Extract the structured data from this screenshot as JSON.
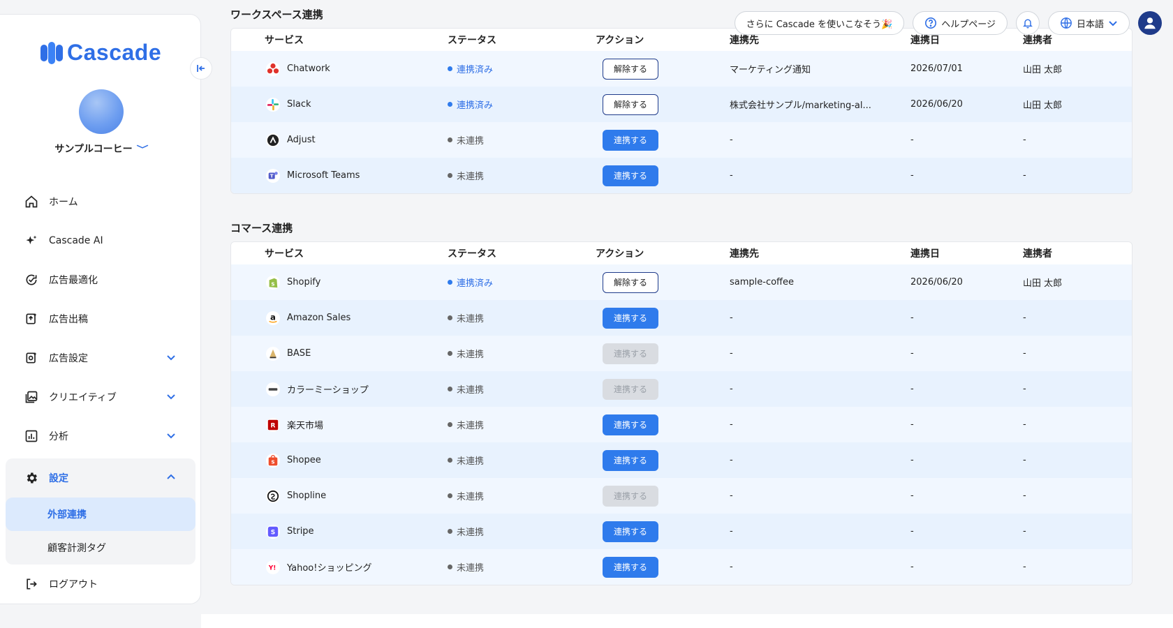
{
  "brand": {
    "name": "Cascade",
    "color": "#2f6fe6"
  },
  "company": {
    "name": "サンプルコーヒー"
  },
  "nav": {
    "items": [
      {
        "label": "ホーム",
        "icon": "home-icon"
      },
      {
        "label": "Cascade AI",
        "icon": "sparkle-icon"
      },
      {
        "label": "広告最適化",
        "icon": "refresh-check-icon"
      },
      {
        "label": "広告出稿",
        "icon": "upload-doc-icon"
      },
      {
        "label": "広告設定",
        "icon": "ad-settings-icon",
        "expandable": true
      },
      {
        "label": "クリエイティブ",
        "icon": "image-gallery-icon",
        "expandable": true
      },
      {
        "label": "分析",
        "icon": "chart-icon",
        "expandable": true
      }
    ],
    "settings": {
      "label": "設定",
      "children": [
        {
          "label": "外部連携",
          "active": true
        },
        {
          "label": "顧客計測タグ",
          "active": false
        }
      ]
    },
    "logout": "ログアウト"
  },
  "topbar": {
    "promo": "さらに Cascade を使いこなそう🎉",
    "help": "ヘルプページ",
    "language": "日本語"
  },
  "columns": {
    "service": "サービス",
    "status": "ステータス",
    "action": "アクション",
    "destination": "連携先",
    "date": "連携日",
    "user": "連携者"
  },
  "labels": {
    "connected": "連携済み",
    "not_connected": "未連携",
    "disconnect": "解除する",
    "connect": "連携する"
  },
  "workspace": {
    "title": "ワークスペース連携",
    "rows": [
      {
        "service": "Chatwork",
        "icon": "chatwork-icon",
        "connected": true,
        "destination": "マーケティング通知",
        "date": "2026/07/01",
        "user": "山田 太郎"
      },
      {
        "service": "Slack",
        "icon": "slack-icon",
        "connected": true,
        "destination": "株式会社サンプル/marketing-al...",
        "date": "2026/06/20",
        "user": "山田 太郎"
      },
      {
        "service": "Adjust",
        "icon": "adjust-icon",
        "connected": false,
        "destination": "-",
        "date": "-",
        "user": "-"
      },
      {
        "service": "Microsoft Teams",
        "icon": "teams-icon",
        "connected": false,
        "destination": "-",
        "date": "-",
        "user": "-"
      }
    ]
  },
  "commerce": {
    "title": "コマース連携",
    "rows": [
      {
        "service": "Shopify",
        "icon": "shopify-icon",
        "connected": true,
        "destination": "sample-coffee",
        "date": "2026/06/20",
        "user": "山田 太郎"
      },
      {
        "service": "Amazon Sales",
        "icon": "amazon-icon",
        "connected": false,
        "disabled": false,
        "destination": "-",
        "date": "-",
        "user": "-"
      },
      {
        "service": "BASE",
        "icon": "base-icon",
        "connected": false,
        "disabled": true,
        "destination": "-",
        "date": "-",
        "user": "-"
      },
      {
        "service": "カラーミーショップ",
        "icon": "colorme-icon",
        "connected": false,
        "disabled": true,
        "destination": "-",
        "date": "-",
        "user": "-"
      },
      {
        "service": "楽天市場",
        "icon": "rakuten-icon",
        "connected": false,
        "disabled": false,
        "destination": "-",
        "date": "-",
        "user": "-"
      },
      {
        "service": "Shopee",
        "icon": "shopee-icon",
        "connected": false,
        "disabled": false,
        "destination": "-",
        "date": "-",
        "user": "-"
      },
      {
        "service": "Shopline",
        "icon": "shopline-icon",
        "connected": false,
        "disabled": true,
        "destination": "-",
        "date": "-",
        "user": "-"
      },
      {
        "service": "Stripe",
        "icon": "stripe-icon",
        "connected": false,
        "disabled": false,
        "destination": "-",
        "date": "-",
        "user": "-"
      },
      {
        "service": "Yahoo!ショッピング",
        "icon": "yahoo-icon",
        "connected": false,
        "disabled": false,
        "destination": "-",
        "date": "-",
        "user": "-"
      }
    ]
  }
}
